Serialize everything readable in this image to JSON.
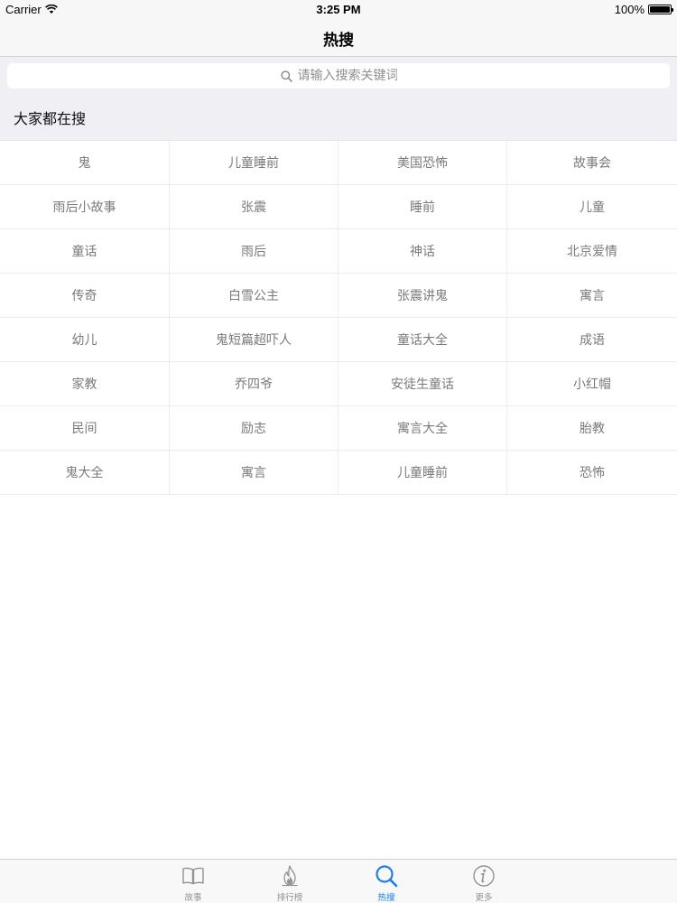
{
  "status_bar": {
    "carrier": "Carrier",
    "time": "3:25 PM",
    "battery": "100%"
  },
  "nav": {
    "title": "热搜"
  },
  "search": {
    "placeholder": "请输入搜索关键词"
  },
  "section": {
    "title": "大家都在搜"
  },
  "keywords": [
    [
      "鬼",
      "儿童睡前",
      "美国恐怖",
      "故事会"
    ],
    [
      "雨后小故事",
      "张震",
      "睡前",
      "儿童"
    ],
    [
      "童话",
      "雨后",
      "神话",
      "北京爱情"
    ],
    [
      "传奇",
      "白雪公主",
      "张震讲鬼",
      "寓言"
    ],
    [
      "幼儿",
      "鬼短篇超吓人",
      "童话大全",
      "成语"
    ],
    [
      "家教",
      "乔四爷",
      "安徒生童话",
      "小红帽"
    ],
    [
      "民间",
      "励志",
      "寓言大全",
      "胎教"
    ],
    [
      "鬼大全",
      "寓言",
      "儿童睡前",
      "恐怖"
    ]
  ],
  "tabs": [
    {
      "label": "故事",
      "icon": "book-icon",
      "active": false
    },
    {
      "label": "排行榜",
      "icon": "flame-icon",
      "active": false
    },
    {
      "label": "热搜",
      "icon": "search-icon",
      "active": true
    },
    {
      "label": "更多",
      "icon": "info-icon",
      "active": false
    }
  ],
  "colors": {
    "accent": "#1a7ef5",
    "tab_inactive": "#929292",
    "grid_text": "#7a7a7a",
    "section_bg": "#efeff4"
  }
}
